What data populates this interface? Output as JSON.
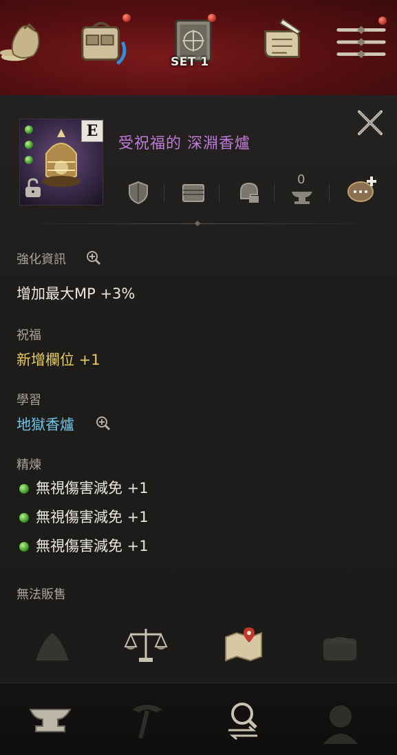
{
  "top_bar": {
    "icons": [
      {
        "name": "money-bag-icon",
        "badge": false
      },
      {
        "name": "inventory-bag-icon",
        "badge": true
      },
      {
        "name": "equipment-set-book-icon",
        "badge": true
      },
      {
        "name": "quest-scroll-icon",
        "badge": false
      },
      {
        "name": "menu-icon",
        "badge": true
      }
    ],
    "set_label": "SET 1"
  },
  "item": {
    "grade": "E",
    "name": "受祝福的 深淵香爐",
    "name_color": "#c07ad8",
    "socket_count": 3
  },
  "actions": [
    {
      "name": "shield-icon"
    },
    {
      "name": "storage-chest-icon"
    },
    {
      "name": "helmet-swap-icon"
    },
    {
      "name": "anvil-enhance-icon",
      "count": "0"
    },
    {
      "name": "chat-add-icon"
    }
  ],
  "sections": {
    "enhance_label": "強化資訊",
    "enhance_value": "增加最大MP +3%",
    "blessing_label": "祝福",
    "blessing_value": "新增欄位 +1",
    "learn_label": "學習",
    "learn_value": "地獄香爐",
    "refine_label": "精煉",
    "refine_items": [
      "無視傷害減免 +1",
      "無視傷害減免 +1",
      "無視傷害減免 +1"
    ],
    "unsellable": "無法販售"
  },
  "colors": {
    "value_white": "#ece8e0",
    "blessing_yellow": "#e8cc5a",
    "learn_blue": "#6fc4e8"
  }
}
